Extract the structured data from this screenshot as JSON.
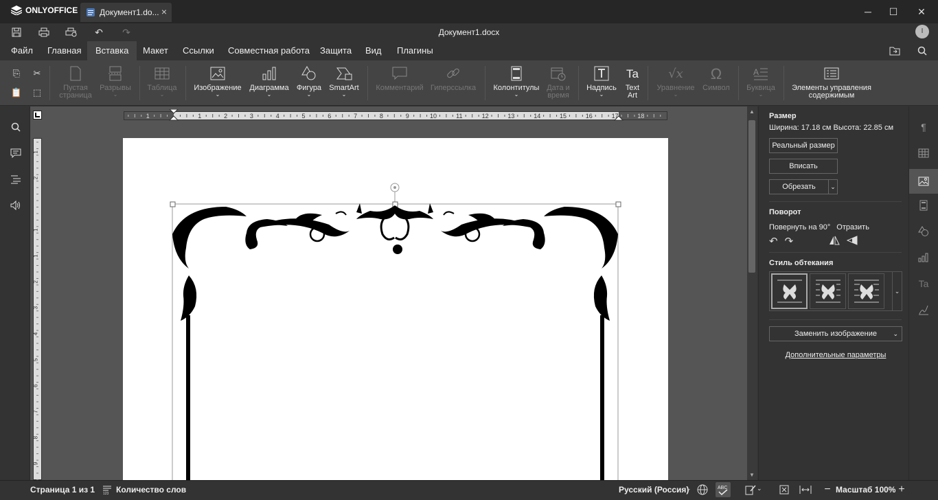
{
  "app": {
    "brand": "ONLYOFFICE",
    "tab_title": "Документ1.do...",
    "doc_title": "Документ1.docx",
    "user_initial": "I"
  },
  "window": {
    "minimize": "─",
    "maximize": "☐",
    "close": "✕"
  },
  "menu": {
    "items": [
      "Файл",
      "Главная",
      "Вставка",
      "Макет",
      "Ссылки",
      "Совместная работа",
      "Защита",
      "Вид",
      "Плагины"
    ],
    "active_index": 2
  },
  "ribbon": {
    "blank_page": "Пустая страница",
    "breaks": "Разрывы",
    "table": "Таблица",
    "image": "Изображение",
    "chart": "Диаграмма",
    "shape": "Фигура",
    "smartart": "SmartArt",
    "comment": "Комментарий",
    "hyperlink": "Гиперссылка",
    "header_footer": "Колонтитулы",
    "date_time": "Дата и время",
    "textbox": "Надпись",
    "textart": "Text Art",
    "equation": "Уравнение",
    "symbol": "Символ",
    "dropcap": "Буквица",
    "content_controls": "Элементы управления содержимым"
  },
  "ruler": {
    "marks": [
      "1",
      "1",
      "2",
      "3",
      "4",
      "5",
      "6",
      "7",
      "8",
      "9",
      "10",
      "11",
      "12",
      "13",
      "14",
      "15",
      "16",
      "17",
      "18"
    ]
  },
  "vruler": {
    "marks": [
      "1",
      "2",
      "1",
      "1",
      "2",
      "3",
      "4",
      "5",
      "6",
      "7",
      "8",
      "9",
      "10"
    ]
  },
  "right_panel": {
    "size_title": "Размер",
    "size_text": "Ширина: 17.18 см  Высота: 22.85 см",
    "actual_size": "Реальный размер",
    "fit": "Вписать",
    "crop": "Обрезать",
    "rotation_title": "Поворот",
    "rotate_90": "Повернуть на 90°",
    "flip": "Отразить",
    "wrap_title": "Стиль обтекания",
    "replace_image": "Заменить изображение",
    "advanced": "Дополнительные параметры"
  },
  "status": {
    "page": "Страница 1 из 1",
    "word_count": "Количество слов",
    "language": "Русский (Россия)",
    "zoom": "Масштаб 100%"
  },
  "colors": {
    "bg": "#333333",
    "ribbon": "#444444",
    "active_tab": "#444444",
    "page": "#ffffff",
    "workspace": "#555555"
  }
}
